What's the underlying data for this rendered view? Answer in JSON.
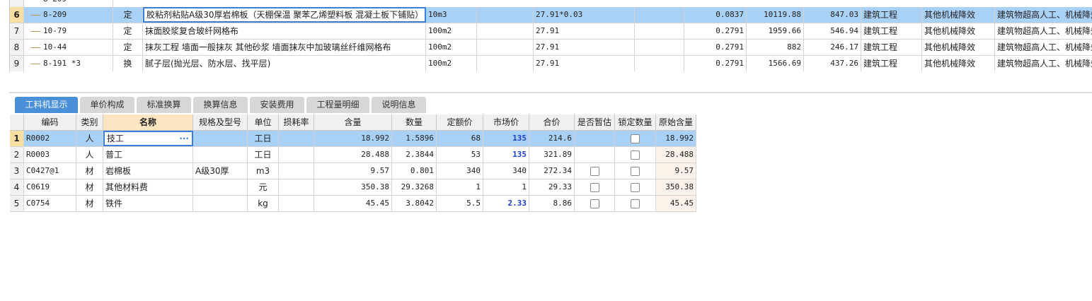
{
  "upper_rows": [
    {
      "num": "",
      "code": "8-209",
      "type": "",
      "name": "",
      "unit": "",
      "expr": "",
      "qty": "",
      "price": "",
      "total": "",
      "major": "",
      "fee_type": "",
      "note": "",
      "partial": true
    },
    {
      "num": "6",
      "code": "8-209",
      "type": "定",
      "name": "胶粘剂粘贴A级30厚岩棉板（天棚保温 聚苯乙烯塑料板 混凝土板下铺贴）",
      "unit": "10m3",
      "expr": "27.91*0.03",
      "qty": "0.0837",
      "price": "10119.88",
      "total": "847.03",
      "major": "建筑工程",
      "fee_type": "其他机械降效",
      "note": "建筑物超高人工、机械降效",
      "selected": true
    },
    {
      "num": "7",
      "code": "10-79",
      "type": "定",
      "name": "抹面胶浆复合玻纤网格布",
      "unit": "100m2",
      "expr": "27.91",
      "qty": "0.2791",
      "price": "1959.66",
      "total": "546.94",
      "major": "建筑工程",
      "fee_type": "其他机械降效",
      "note": "建筑物超高人工、机械降效"
    },
    {
      "num": "8",
      "code": "10-44",
      "type": "定",
      "name": "抹灰工程 墙面一般抹灰 其他砂浆 墙面抹灰中加玻璃丝纤维网格布",
      "unit": "100m2",
      "expr": "27.91",
      "qty": "0.2791",
      "price": "882",
      "total": "246.17",
      "major": "建筑工程",
      "fee_type": "其他机械降效",
      "note": "建筑物超高人工、机械降效"
    },
    {
      "num": "9",
      "code": "8-191 *3",
      "type": "换",
      "name": "腻子层(抛光层、防水层、找平层)",
      "unit": "100m2",
      "expr": "27.91",
      "qty": "0.2791",
      "price": "1566.69",
      "total": "437.26",
      "major": "建筑工程",
      "fee_type": "其他机械降效",
      "note": "建筑物超高人工、机械降效"
    }
  ],
  "tabs": [
    "工料机显示",
    "单价构成",
    "标准换算",
    "换算信息",
    "安装费用",
    "工程量明细",
    "说明信息"
  ],
  "headers": [
    "编码",
    "类别",
    "名称",
    "规格及型号",
    "单位",
    "损耗率",
    "含量",
    "数量",
    "定额价",
    "市场价",
    "合价",
    "是否暂估",
    "锁定数量",
    "原始含量"
  ],
  "rows": [
    {
      "num": "1",
      "code": "R0002",
      "cat": "人",
      "name": "技工",
      "spec": "",
      "unit": "工日",
      "loss": "",
      "content": "18.992",
      "qty": "1.5896",
      "base": "68",
      "market": "135",
      "total": "214.6",
      "est": false,
      "lock": true,
      "orig": "18.992",
      "selected": true,
      "market_blue": true
    },
    {
      "num": "2",
      "code": "R0003",
      "cat": "人",
      "name": "普工",
      "spec": "",
      "unit": "工日",
      "loss": "",
      "content": "28.488",
      "qty": "2.3844",
      "base": "53",
      "market": "135",
      "total": "321.89",
      "est": false,
      "lock": true,
      "orig": "28.488",
      "market_blue": true
    },
    {
      "num": "3",
      "code": "C0427@1",
      "cat": "材",
      "name": "岩棉板",
      "spec": "A级30厚",
      "unit": "m3",
      "loss": "",
      "content": "9.57",
      "qty": "0.801",
      "base": "340",
      "market": "340",
      "total": "272.34",
      "est": true,
      "lock": true,
      "orig": "9.57"
    },
    {
      "num": "4",
      "code": "C0619",
      "cat": "材",
      "name": "其他材料费",
      "spec": "",
      "unit": "元",
      "loss": "",
      "content": "350.38",
      "qty": "29.3268",
      "base": "1",
      "market": "1",
      "total": "29.33",
      "est": true,
      "lock": true,
      "orig": "350.38"
    },
    {
      "num": "5",
      "code": "C0754",
      "cat": "材",
      "name": "铁件",
      "spec": "",
      "unit": "kg",
      "loss": "",
      "content": "45.45",
      "qty": "3.8042",
      "base": "5.5",
      "market": "2.33",
      "total": "8.86",
      "est": true,
      "lock": true,
      "orig": "45.45",
      "market_blue": true
    }
  ],
  "colors": {
    "selected_row": "#a9d0f5",
    "active_tab": "#4a90d9",
    "row_header_selected": "#f7dfa2",
    "highlight_header": "#fde5c2",
    "market_price": "#1a3ccf"
  }
}
